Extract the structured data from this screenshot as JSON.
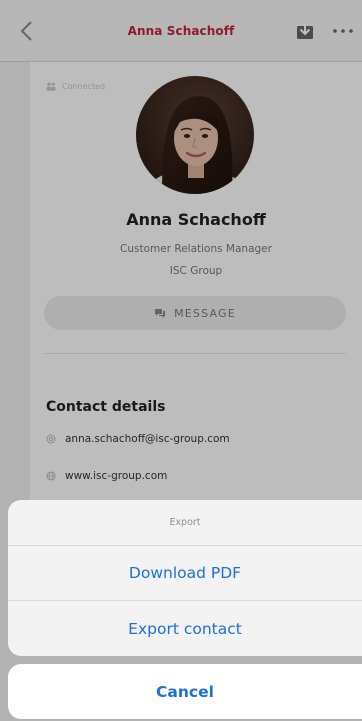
{
  "navbar": {
    "title": "Anna Schachoff",
    "title_color": "#c2233d",
    "back_icon": "chevron-left-icon",
    "download_icon": "download-icon",
    "more_icon": "more-horizontal-icon"
  },
  "profile": {
    "status": "Connected",
    "name": "Anna Schachoff",
    "role": "Customer Relations Manager",
    "company": "ISC Group",
    "message_label": "MESSAGE"
  },
  "contact": {
    "section_title": "Contact details",
    "email": "anna.schachoff@isc-group.com",
    "website": "www.isc-group.com"
  },
  "action_sheet": {
    "title": "Export",
    "actions": [
      {
        "label": "Download PDF"
      },
      {
        "label": "Export contact"
      }
    ],
    "cancel_label": "Cancel",
    "accent_color": "#1e6fd9"
  }
}
